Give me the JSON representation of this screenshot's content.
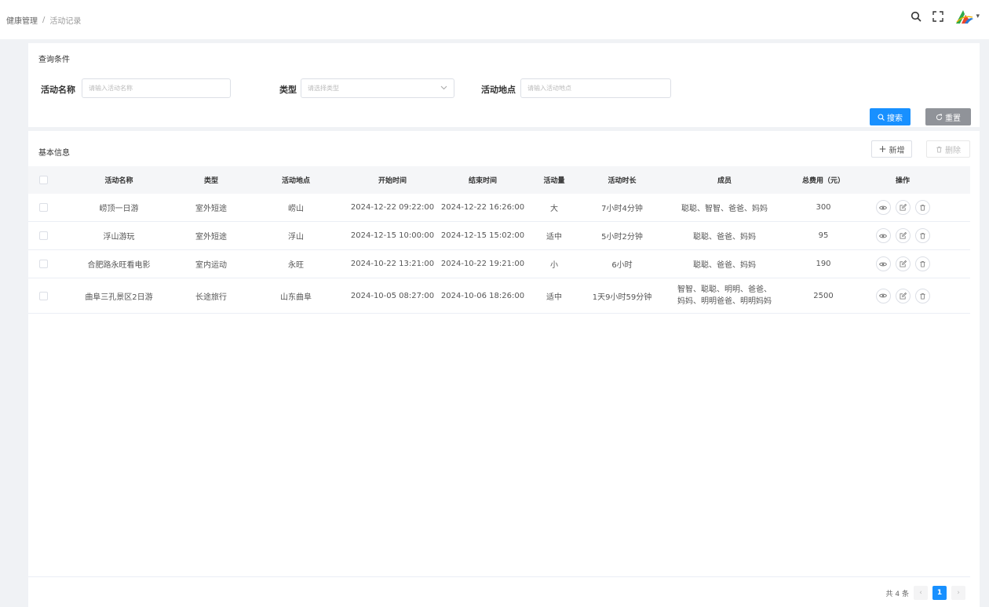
{
  "breadcrumb": {
    "root": "健康管理",
    "separator": "/",
    "current": "活动记录"
  },
  "header": {
    "search_icon": "search-icon",
    "fullscreen_icon": "fullscreen-icon",
    "logo_icon": "app-logo-icon",
    "caret": "▾"
  },
  "query": {
    "title": "查询条件",
    "name_label": "活动名称",
    "name_placeholder": "请输入活动名称",
    "type_label": "类型",
    "type_placeholder": "请选择类型",
    "location_label": "活动地点",
    "location_placeholder": "请输入活动地点",
    "search_label": "搜索",
    "reset_label": "重置"
  },
  "info": {
    "title": "基本信息",
    "add_label": "新增",
    "delete_label": "删除"
  },
  "table": {
    "headers": [
      "活动名称",
      "类型",
      "活动地点",
      "开始时间",
      "结束时间",
      "活动量",
      "活动时长",
      "成员",
      "总费用（元）",
      "操作"
    ],
    "rows": [
      {
        "name": "崂顶一日游",
        "type": "室外短途",
        "location": "崂山",
        "start": "2024-12-22 09:22:00",
        "end": "2024-12-22 16:26:00",
        "volume": "大",
        "duration": "7小时4分钟",
        "members": "聪聪、智智、爸爸、妈妈",
        "fee": "300"
      },
      {
        "name": "浮山游玩",
        "type": "室外短途",
        "location": "浮山",
        "start": "2024-12-15 10:00:00",
        "end": "2024-12-15 15:02:00",
        "volume": "适中",
        "duration": "5小时2分钟",
        "members": "聪聪、爸爸、妈妈",
        "fee": "95"
      },
      {
        "name": "合肥路永旺看电影",
        "type": "室内运动",
        "location": "永旺",
        "start": "2024-10-22 13:21:00",
        "end": "2024-10-22 19:21:00",
        "volume": "小",
        "duration": "6小时",
        "members": "聪聪、爸爸、妈妈",
        "fee": "190"
      },
      {
        "name": "曲阜三孔景区2日游",
        "type": "长途旅行",
        "location": "山东曲阜",
        "start": "2024-10-05 08:27:00",
        "end": "2024-10-06 18:26:00",
        "volume": "适中",
        "duration": "1天9小时59分钟",
        "members": "智智、聪聪、明明、爸爸、妈妈、明明爸爸、明明妈妈",
        "fee": "2500"
      }
    ]
  },
  "pagination": {
    "total_text": "共 4 条",
    "current_page": "1",
    "prev": "‹",
    "next": "›"
  },
  "colors": {
    "primary": "#1890ff",
    "reset": "#909399"
  }
}
